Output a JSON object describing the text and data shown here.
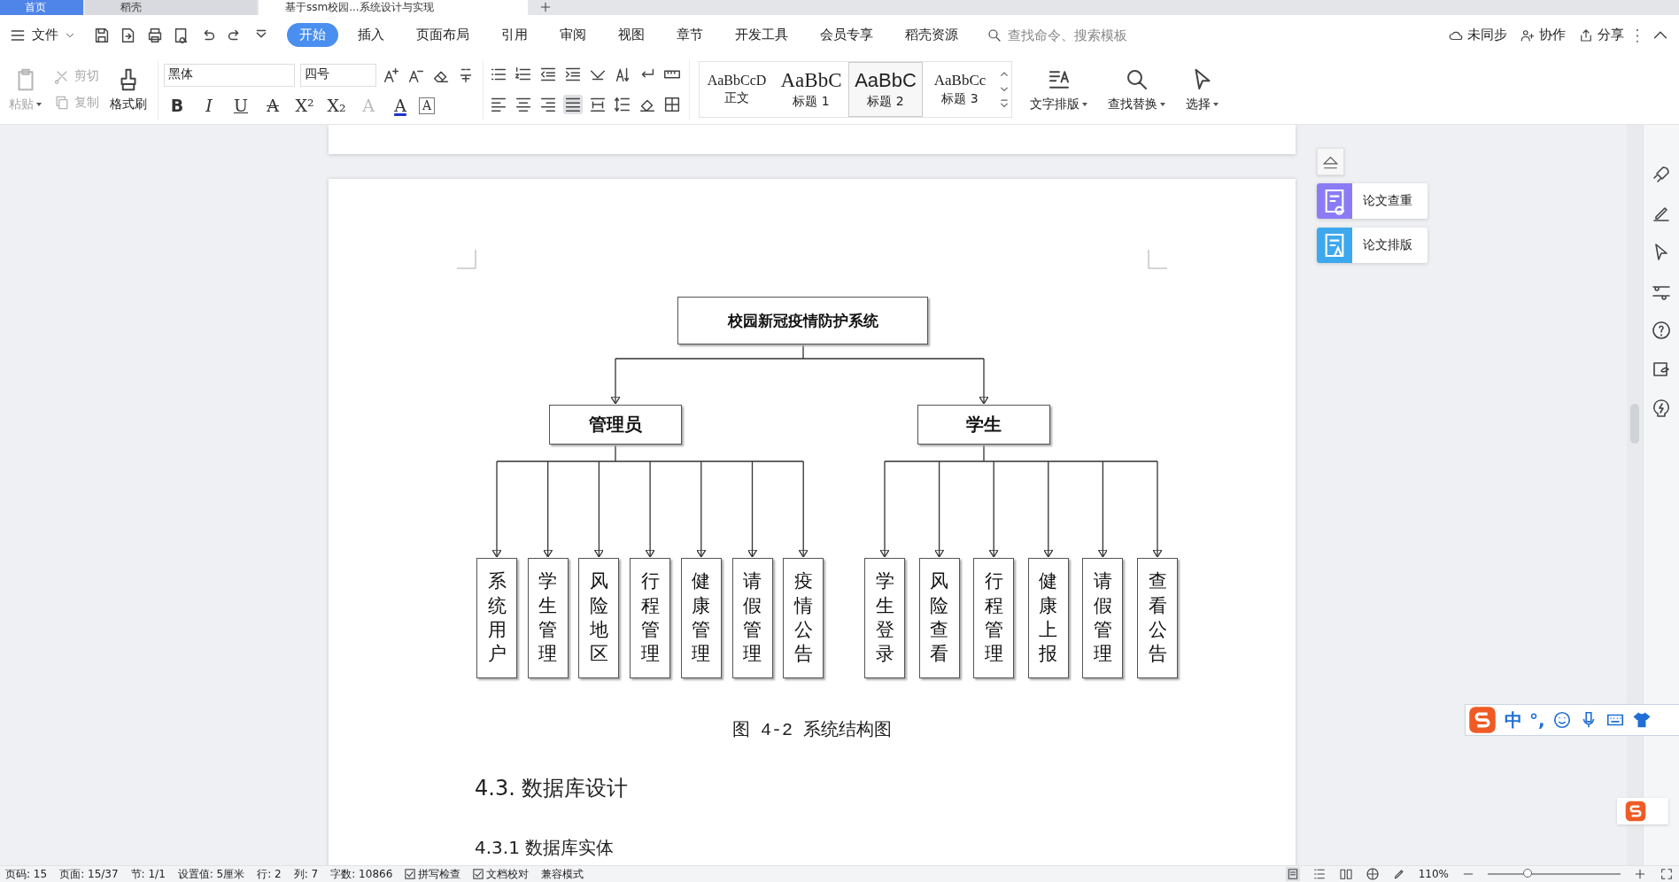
{
  "tabs": [
    {
      "label": "首页",
      "kind": "home",
      "selected": false
    },
    {
      "label": "稻壳",
      "kind": "app",
      "selected": false
    },
    {
      "label": "基于ssm校园...系统设计与实现",
      "kind": "doc",
      "selected": true
    }
  ],
  "menu": {
    "file": "文件",
    "items": [
      {
        "label": "开始",
        "selected": true
      },
      {
        "label": "插入",
        "selected": false
      },
      {
        "label": "页面布局",
        "selected": false
      },
      {
        "label": "引用",
        "selected": false
      },
      {
        "label": "审阅",
        "selected": false
      },
      {
        "label": "视图",
        "selected": false
      },
      {
        "label": "章节",
        "selected": false
      },
      {
        "label": "开发工具",
        "selected": false
      },
      {
        "label": "会员专享",
        "selected": false
      },
      {
        "label": "稻壳资源",
        "selected": false
      }
    ],
    "search": {
      "placeholder": "查找命令、搜索模板"
    },
    "actions": [
      "未同步",
      "协作",
      "分享"
    ]
  },
  "ribbon": {
    "clipboard": [
      {
        "label": "粘贴",
        "kind": "paste",
        "disabled": true
      },
      {
        "label": "剪切",
        "kind": "cut",
        "disabled": true
      },
      {
        "label": "复制",
        "kind": "copy",
        "disabled": true
      },
      {
        "label": "格式刷",
        "kind": "painter",
        "disabled": false
      }
    ],
    "font": {
      "name": "黑体",
      "size": "四号",
      "buttons": [
        {
          "label": "B",
          "kind": "bold"
        },
        {
          "label": "I",
          "kind": "italic"
        },
        {
          "label": "U",
          "kind": "underline"
        },
        {
          "label": "A",
          "kind": "strike"
        },
        {
          "label": "X²",
          "kind": "plain"
        },
        {
          "label": "X₂",
          "kind": "plain"
        },
        {
          "label": "A",
          "kind": "effect"
        },
        {
          "label": "A",
          "kind": "color"
        },
        {
          "label": "A",
          "kind": "boxed"
        }
      ]
    },
    "align_buttons": [
      {
        "kind": "left",
        "selected": false
      },
      {
        "kind": "center",
        "selected": false
      },
      {
        "kind": "right",
        "selected": false
      },
      {
        "kind": "justify",
        "selected": true
      },
      {
        "kind": "distributed",
        "selected": false
      }
    ],
    "styles": [
      {
        "preview": "AaBbCcD",
        "label": "正文",
        "kind": "body",
        "selected": false
      },
      {
        "preview": "AaBbC",
        "label": "标题 1",
        "kind": "h1",
        "selected": false
      },
      {
        "preview": "AaBbC",
        "label": "标题 2",
        "kind": "h2",
        "selected": true
      },
      {
        "preview": "AaBbCc",
        "label": "标题 3",
        "kind": "h3",
        "selected": false
      }
    ],
    "tools": [
      {
        "label": "文字排版",
        "kind": "layout"
      },
      {
        "label": "查找替换",
        "kind": "find"
      },
      {
        "label": "选择",
        "kind": "select"
      }
    ]
  },
  "document": {
    "diagram": {
      "root": "校园新冠疫情防护系统",
      "branches": [
        {
          "label": "管理员",
          "children": [
            "系统用户",
            "学生管理",
            "风险地区",
            "行程管理",
            "健康管理",
            "请假管理",
            "疫情公告"
          ]
        },
        {
          "label": "学生",
          "children": [
            "学生登录",
            "风险查看",
            "行程管理",
            "健康上报",
            "请假管理",
            "查看公告"
          ]
        }
      ]
    },
    "caption": "图 4-2 系统结构图",
    "heading": "4.3. 数据库设计",
    "subheading": "4.3.1 数据库实体"
  },
  "side_cards": [
    {
      "label": "论文查重",
      "color": "#8b7cf6",
      "kind": "check"
    },
    {
      "label": "论文排版",
      "color": "#3ea8ef",
      "kind": "format"
    }
  ],
  "ime": {
    "mode": "中",
    "punct": "°,"
  },
  "status_bar": {
    "items": [
      "页码: 15",
      "页面: 15/37",
      "节: 1/1",
      "设置值: 5厘米",
      "行: 2",
      "列: 7",
      "字数: 10866"
    ],
    "checks": [
      {
        "label": "拼写检查",
        "checked": true
      },
      {
        "label": "文档校对",
        "checked": true
      }
    ],
    "mode": "兼容模式",
    "views": [
      {
        "kind": "page",
        "selected": true
      },
      {
        "kind": "outline",
        "selected": false
      },
      {
        "kind": "read",
        "selected": false
      },
      {
        "kind": "web",
        "selected": false
      },
      {
        "kind": "write",
        "selected": false
      }
    ],
    "zoom": "110%",
    "zoom_slider": {
      "level": 0.3
    }
  }
}
